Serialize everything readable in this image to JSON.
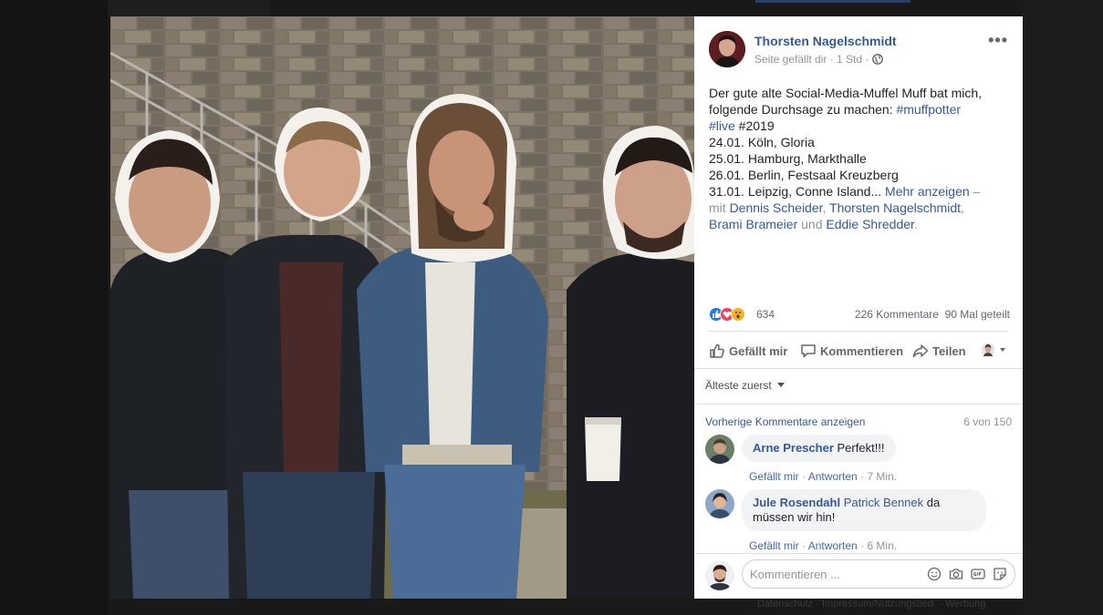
{
  "post": {
    "author": "Thorsten Nagelschmidt",
    "meta": "Seite gefällt dir · 1 Std ·",
    "text": {
      "line1": "Der gute alte Social-Media-Muffel Muff bat mich,",
      "line2_pre": "folgende Durchsage zu machen: ",
      "hashtag1": "#muffpotter",
      "hashtag2": "#live",
      "line3_rest": " #2019",
      "date1": "24.01. Köln, Gloria",
      "date2": "25.01. Hamburg, Markthalle",
      "date3": "26.01. Berlin, Festsaal Kreuzberg",
      "date4": "31.01. Leipzig, Conne Island... ",
      "more": "Mehr anzeigen",
      "dash": " –",
      "mit": "mit ",
      "tag1": "Dennis Scheider",
      "comma1": ", ",
      "tag2": "Thorsten Nagelschmidt",
      "comma2": ",",
      "tag3": "Brami Brameier",
      "und": " und ",
      "tag4": "Eddie Shredder",
      "period": "."
    }
  },
  "reactions": {
    "count": "634",
    "comments": "226 Kommentare",
    "shares": "90 Mal geteilt"
  },
  "actions": {
    "like": "Gefällt mir",
    "comment": "Kommentieren",
    "share": "Teilen"
  },
  "comments_section": {
    "sort": "Älteste zuerst",
    "previous": "Vorherige Kommentare anzeigen",
    "count": "6 von 150",
    "items": [
      {
        "name": "Arne Prescher",
        "text": "Perfekt!!!",
        "like": "Gefällt mir",
        "reply": "Antworten",
        "time": "7 Min."
      },
      {
        "name": "Jule Rosendahl",
        "tag": "Patrick Bennek",
        "text_line1": " da",
        "text_line2": "müssen wir hin!",
        "like": "Gefällt mir",
        "reply": "Antworten",
        "time": "6 Min."
      }
    ],
    "placeholder": "Kommentieren ..."
  },
  "footer": "Datenschutz · Impressum/Nutzungsbed. · Werbung",
  "colors": {
    "link": "#365899",
    "like_blue": "#2078f4",
    "love_red": "#f33e58",
    "wow_yellow": "#f7b125",
    "backdrop": "#191919"
  }
}
